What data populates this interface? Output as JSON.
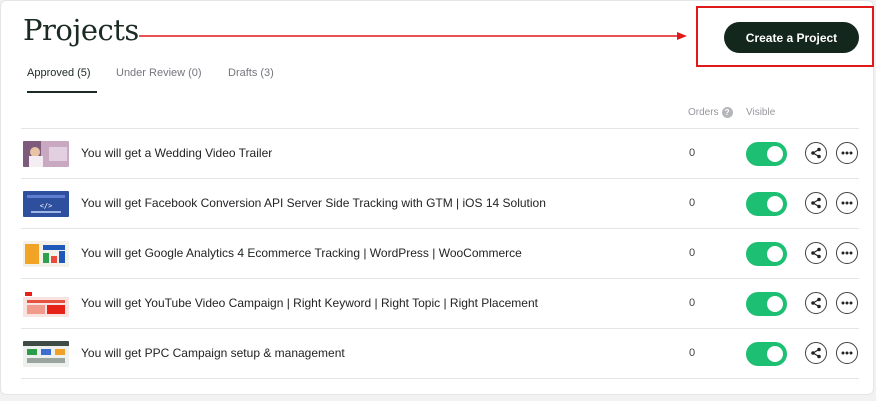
{
  "header": {
    "title": "Projects",
    "create_button_label": "Create a Project"
  },
  "tabs": [
    {
      "label": "Approved (5)",
      "active": true
    },
    {
      "label": "Under Review (0)",
      "active": false
    },
    {
      "label": "Drafts (3)",
      "active": false
    }
  ],
  "columns": {
    "orders": "Orders",
    "visible": "Visible"
  },
  "icons": {
    "help": "question-circle-icon",
    "share": "share-icon",
    "more": "more-horizontal-icon"
  },
  "colors": {
    "primary_button": "#13271c",
    "toggle_on": "#1dbf73",
    "highlight": "#e0191b"
  },
  "projects": [
    {
      "title": "You will get a Wedding Video Trailer",
      "orders": "0",
      "visible": true
    },
    {
      "title": "You will get Facebook Conversion API Server Side Tracking with GTM | iOS 14 Solution",
      "orders": "0",
      "visible": true
    },
    {
      "title": "You will get Google Analytics 4 Ecommerce Tracking | WordPress | WooCommerce",
      "orders": "0",
      "visible": true
    },
    {
      "title": "You will get YouTube Video Campaign | Right Keyword | Right Topic | Right Placement",
      "orders": "0",
      "visible": true
    },
    {
      "title": "You will get PPC Campaign setup & management",
      "orders": "0",
      "visible": true
    }
  ]
}
